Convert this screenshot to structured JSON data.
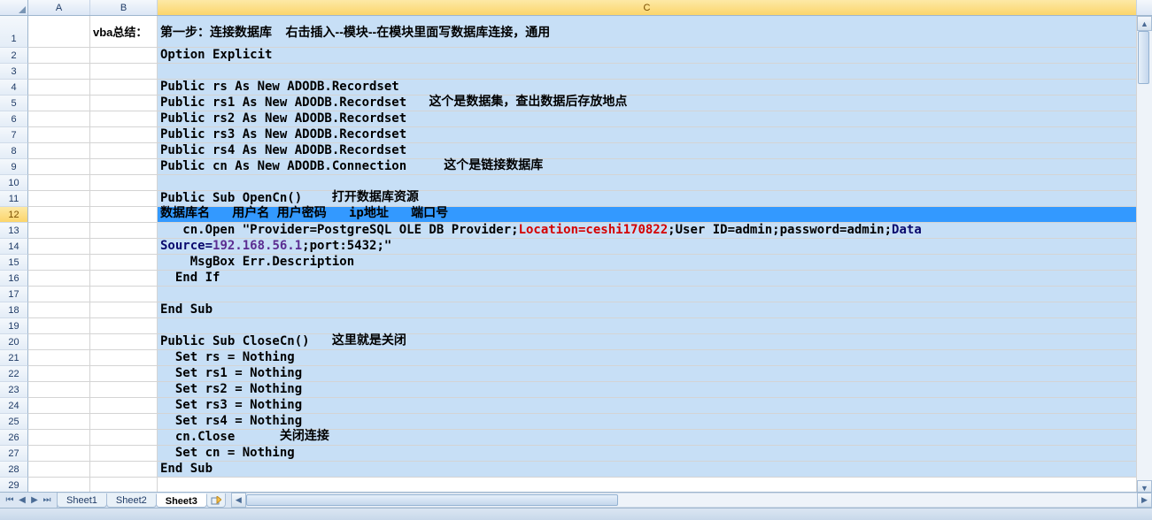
{
  "columns": [
    "A",
    "B",
    "C"
  ],
  "row_numbers": [
    1,
    2,
    3,
    4,
    5,
    6,
    7,
    8,
    9,
    10,
    11,
    12,
    13,
    14,
    15,
    16,
    17,
    18,
    19,
    20,
    21,
    22,
    23,
    24,
    25,
    26,
    27,
    28,
    29
  ],
  "selected_row": 12,
  "selected_col": "C",
  "merged_b_label": "vba总结：",
  "title_row": "第一步：连接数据库    右击插入--模块--在模块里面写数据库连接，通用",
  "code": {
    "r2": "Option Explicit",
    "r3": "",
    "r4": "Public rs As New ADODB.Recordset",
    "r5": {
      "code": "Public rs1 As New ADODB.Recordset   ",
      "cmt": "这个是数据集，查出数据后存放地点"
    },
    "r6": "Public rs2 As New ADODB.Recordset",
    "r7": "Public rs3 As New ADODB.Recordset",
    "r8": "Public rs4 As New ADODB.Recordset",
    "r9": {
      "code": "Public cn As New ADODB.Connection     ",
      "cmt": "这个是链接数据库"
    },
    "r10": "",
    "r11": {
      "code": "Public Sub OpenCn()    ",
      "cmt": "打开数据库资源"
    },
    "r12": "数据库名   用户名 用户密码   ip地址   端口号",
    "r13_pre": "   cn.Open \"Provider=PostgreSQL OLE DB Provider;",
    "r13_loc": "Location=ceshi170822",
    "r13_mid1": ";User ID=admin;password=admin;",
    "r13_data": "Data",
    "r14_pre": "Source=",
    "r14_ip": "192.168.56.1",
    "r14_post": ";port:5432;\"",
    "r15": "    MsgBox Err.Description",
    "r16": "  End If",
    "r17": "",
    "r18": "End Sub",
    "r19": "",
    "r20": {
      "code": "Public Sub CloseCn()   ",
      "cmt": "这里就是关闭"
    },
    "r21": "  Set rs = Nothing",
    "r22": "  Set rs1 = Nothing",
    "r23": "  Set rs2 = Nothing",
    "r24": "  Set rs3 = Nothing",
    "r25": "  Set rs4 = Nothing",
    "r26": {
      "code": "  cn.Close      ",
      "cmt": "关闭连接"
    },
    "r27": "  Set cn = Nothing",
    "r28": "End Sub"
  },
  "tabs": {
    "sheet1": "Sheet1",
    "sheet2": "Sheet2",
    "sheet3": "Sheet3"
  },
  "active_tab": "Sheet3"
}
